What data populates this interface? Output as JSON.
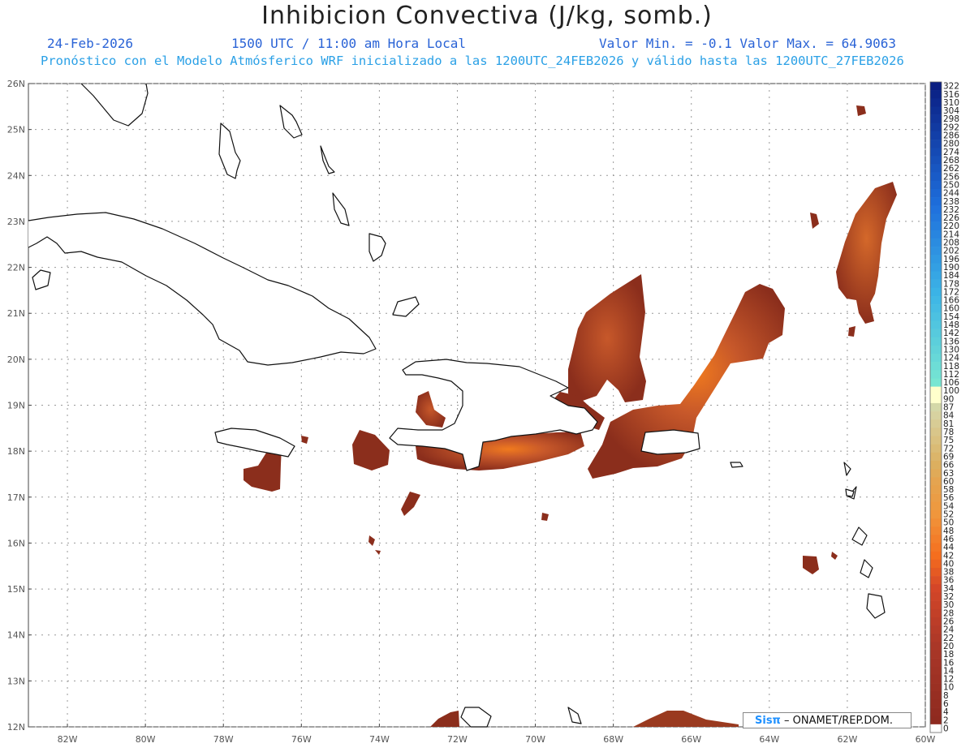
{
  "header": {
    "title": "Inhibicion Convectiva (J/kg, somb.)",
    "date": "24-Feb-2026",
    "time": "1500 UTC / 11:00 am Hora Local",
    "minmax": "Valor Min. = -0.1  Valor Max. = 64.9063",
    "model_note": "Pronóstico con el Modelo Atmósferico WRF inicializado a las 1200UTC_24FEB2026 y válido hasta las  1200UTC_27FEB2026"
  },
  "map": {
    "lat_labels": [
      "26N",
      "25N",
      "24N",
      "23N",
      "22N",
      "21N",
      "20N",
      "19N",
      "18N",
      "17N",
      "16N",
      "15N",
      "14N",
      "13N",
      "12N"
    ],
    "lon_labels": [
      "82W",
      "80W",
      "78W",
      "76W",
      "74W",
      "72W",
      "70W",
      "68W",
      "66W",
      "64W",
      "62W",
      "60W"
    ],
    "lat_range": [
      12,
      26
    ],
    "lon_range": [
      -83,
      -60
    ],
    "grid": true,
    "colors": {
      "shade_dark": "#8b2e1c",
      "shade_mid": "#a8441f",
      "shade_hot": "#f07a1e",
      "coast": "#111111"
    }
  },
  "colorbar": {
    "labels": [
      "322",
      "316",
      "310",
      "304",
      "298",
      "292",
      "286",
      "280",
      "274",
      "268",
      "262",
      "256",
      "250",
      "244",
      "238",
      "232",
      "226",
      "220",
      "214",
      "208",
      "202",
      "196",
      "190",
      "184",
      "178",
      "172",
      "166",
      "160",
      "154",
      "148",
      "142",
      "136",
      "130",
      "124",
      "118",
      "112",
      "106",
      "100",
      "90",
      "87",
      "84",
      "81",
      "78",
      "75",
      "72",
      "69",
      "66",
      "63",
      "60",
      "58",
      "56",
      "54",
      "52",
      "50",
      "48",
      "46",
      "44",
      "42",
      "40",
      "38",
      "36",
      "34",
      "32",
      "30",
      "28",
      "26",
      "24",
      "22",
      "20",
      "18",
      "16",
      "14",
      "12",
      "10",
      "8",
      "6",
      "4",
      "2",
      "0"
    ]
  },
  "credit": {
    "logo": "Sisπ",
    "text": " – ONAMET/REP.DOM."
  }
}
